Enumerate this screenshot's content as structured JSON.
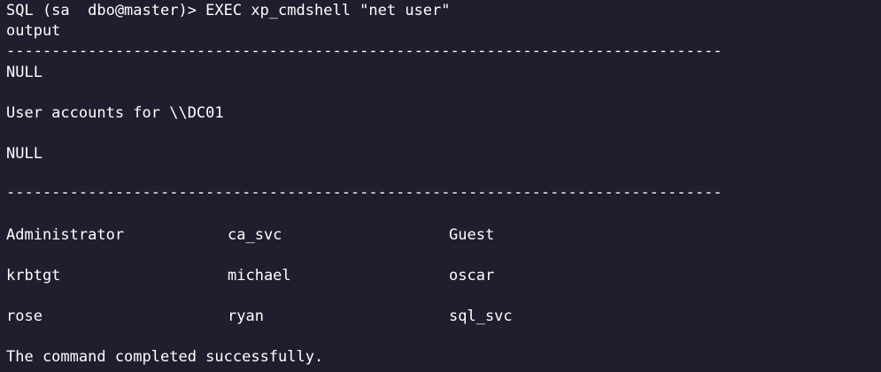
{
  "terminal": {
    "prompt": "SQL (sa  dbo@master)> EXEC xp_cmdshell \"net user\"",
    "column_header": "output",
    "separator": "-------------------------------------------------------------------------------",
    "null_1": "NULL",
    "accounts_line": "User accounts for \\\\DC01",
    "null_2": "NULL",
    "separator_2": "-------------------------------------------------------------------------------",
    "users": [
      [
        "Administrator",
        "ca_svc",
        "Guest"
      ],
      [
        "krbtgt",
        "michael",
        "oscar"
      ],
      [
        "rose",
        "ryan",
        "sql_svc"
      ]
    ],
    "status": "The command completed successfully."
  },
  "colors": {
    "background": "#1e1e2e",
    "text": "#ffffff"
  }
}
